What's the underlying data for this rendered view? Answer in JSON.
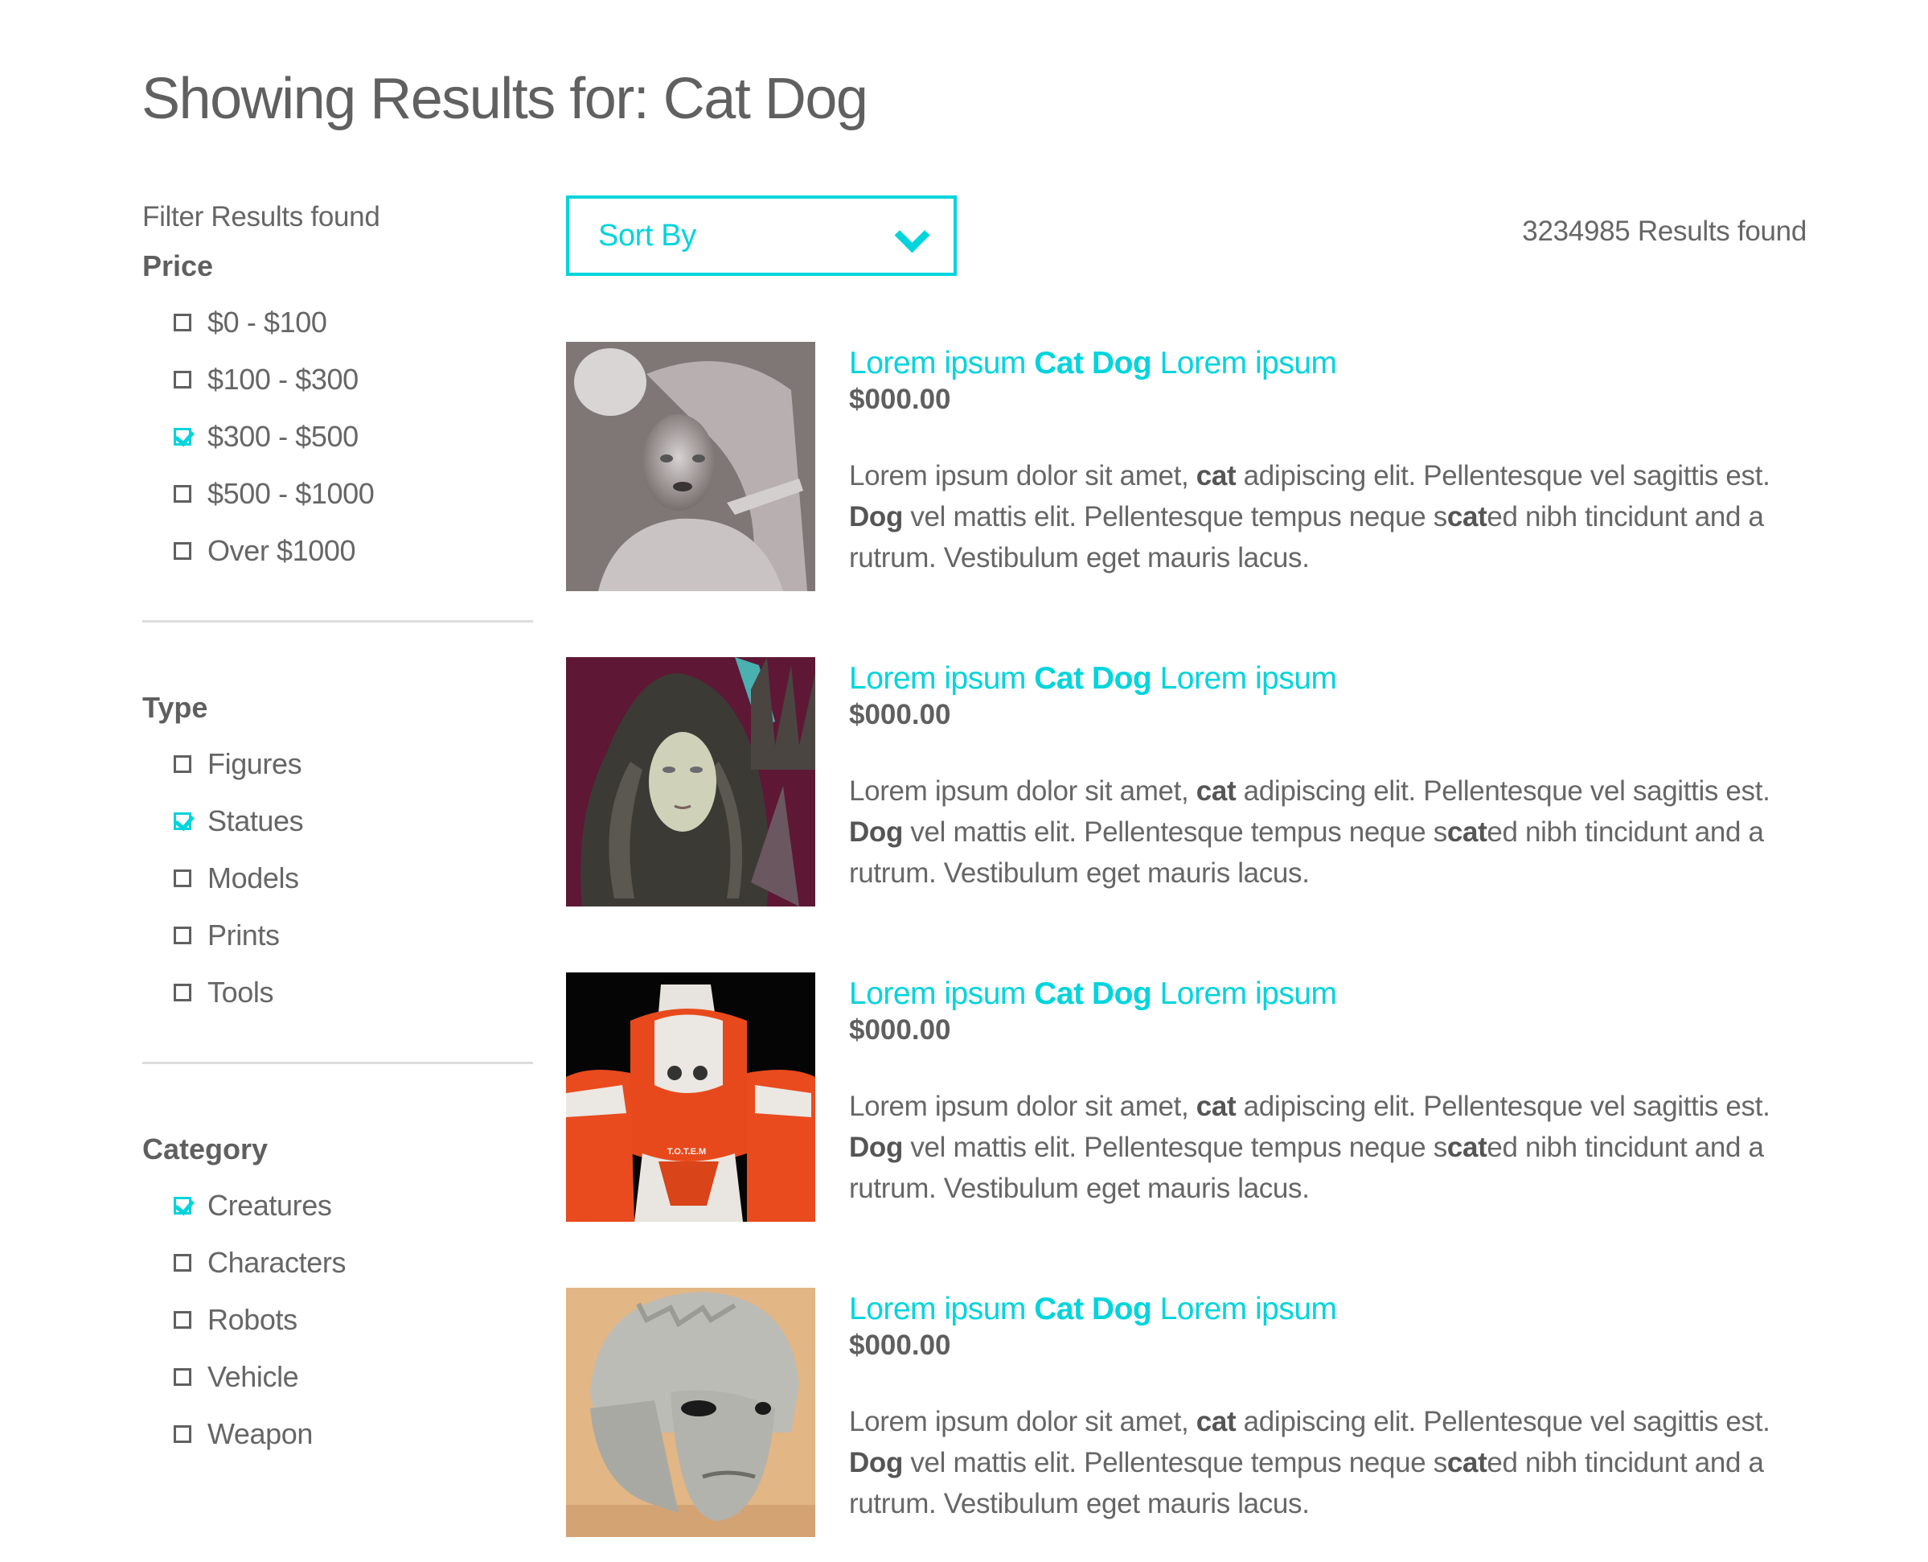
{
  "page": {
    "title": "Showing Results for: Cat Dog"
  },
  "sidebar": {
    "heading": "Filter Results found",
    "groups": [
      {
        "title": "Price",
        "options": [
          {
            "label": "$0 - $100",
            "checked": false
          },
          {
            "label": "$100 - $300",
            "checked": false
          },
          {
            "label": "$300 - $500",
            "checked": true
          },
          {
            "label": "$500 - $1000",
            "checked": false
          },
          {
            "label": "Over $1000",
            "checked": false
          }
        ]
      },
      {
        "title": "Type",
        "options": [
          {
            "label": "Figures",
            "checked": false
          },
          {
            "label": "Statues",
            "checked": true
          },
          {
            "label": "Models",
            "checked": false
          },
          {
            "label": "Prints",
            "checked": false
          },
          {
            "label": "Tools",
            "checked": false
          }
        ]
      },
      {
        "title": "Category",
        "options": [
          {
            "label": "Creatures",
            "checked": true
          },
          {
            "label": "Characters",
            "checked": false
          },
          {
            "label": "Robots",
            "checked": false
          },
          {
            "label": "Vehicle",
            "checked": false
          },
          {
            "label": "Weapon",
            "checked": false
          }
        ]
      }
    ]
  },
  "toolbar": {
    "sort_label": "Sort By",
    "results_count": "3234985 Results found"
  },
  "colors": {
    "accent": "#00d4dc",
    "text": "#666666",
    "divider": "#dcdcdc"
  },
  "results": [
    {
      "image": "skeleton-statue-thumbnail",
      "title_pre": "Lorem ipsum ",
      "title_bold": "Cat Dog",
      "title_post": " Lorem ipsum",
      "price": "$000.00",
      "desc": {
        "l1a": "Lorem ipsum dolor sit amet, ",
        "l1b": "cat",
        "l1c": " adipiscing elit. Pellentesque vel sagittis est.",
        "l2a": "Dog",
        "l2b": " vel mattis elit. Pellentesque tempus neque s",
        "l2c": "cat",
        "l2d": "ed nibh tincidunt and a",
        "l3": "rutrum. Vestibulum eget mauris lacus."
      }
    },
    {
      "image": "alien-queen-statue-thumbnail",
      "title_pre": "Lorem ipsum ",
      "title_bold": "Cat Dog",
      "title_post": " Lorem ipsum",
      "price": "$000.00",
      "desc": {
        "l1a": "Lorem ipsum dolor sit amet, ",
        "l1b": "cat",
        "l1c": " adipiscing elit. Pellentesque vel sagittis est.",
        "l2a": "Dog",
        "l2b": " vel mattis elit. Pellentesque tempus neque s",
        "l2c": "cat",
        "l2d": "ed nibh tincidunt and a",
        "l3": "rutrum. Vestibulum eget mauris lacus."
      }
    },
    {
      "image": "orange-robot-figure-thumbnail",
      "title_pre": "Lorem ipsum ",
      "title_bold": "Cat Dog",
      "title_post": " Lorem ipsum",
      "price": "$000.00",
      "desc": {
        "l1a": "Lorem ipsum dolor sit amet, ",
        "l1b": "cat",
        "l1c": " adipiscing elit. Pellentesque vel sagittis est.",
        "l2a": "Dog",
        "l2b": " vel mattis elit. Pellentesque tempus neque s",
        "l2c": "cat",
        "l2d": "ed nibh tincidunt and a",
        "l3": "rutrum. Vestibulum eget mauris lacus."
      }
    },
    {
      "image": "three-faced-helmet-bust-thumbnail",
      "title_pre": "Lorem ipsum ",
      "title_bold": "Cat Dog",
      "title_post": " Lorem ipsum",
      "price": "$000.00",
      "desc": {
        "l1a": "Lorem ipsum dolor sit amet, ",
        "l1b": "cat",
        "l1c": " adipiscing elit. Pellentesque vel sagittis est.",
        "l2a": "Dog",
        "l2b": " vel mattis elit. Pellentesque tempus neque s",
        "l2c": "cat",
        "l2d": "ed nibh tincidunt and a",
        "l3": "rutrum. Vestibulum eget mauris lacus."
      }
    }
  ]
}
